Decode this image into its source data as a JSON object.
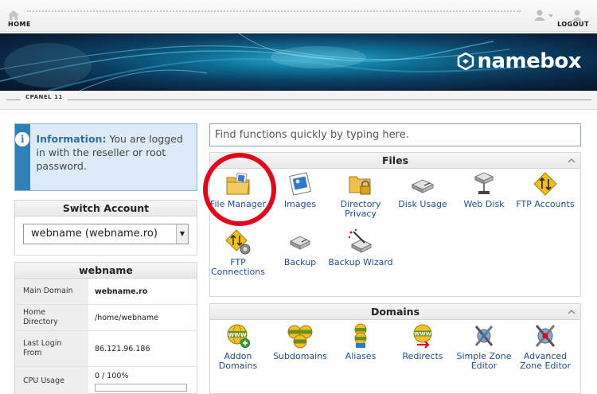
{
  "topbar": {
    "home_label": "HOME",
    "logout_label": "LOGOUT"
  },
  "banner": {
    "logo_text": "namebox"
  },
  "cpanel": {
    "label": "CPANEL 11"
  },
  "info": {
    "title": "Information:",
    "message": "You are logged in with the reseller or root password."
  },
  "switch_account": {
    "title": "Switch Account",
    "selected": "webname (webname.ro)"
  },
  "account": {
    "title": "webname",
    "rows": [
      {
        "label": "Main Domain",
        "value": "webname.ro"
      },
      {
        "label": "Home Directory",
        "value": "/home/webname"
      },
      {
        "label": "Last Login From",
        "value": "86.121.96.186"
      },
      {
        "label": "CPU Usage",
        "value": "0 / 100%"
      }
    ]
  },
  "search": {
    "placeholder": "Find functions quickly by typing here."
  },
  "files": {
    "title": "Files",
    "items": [
      {
        "label": "File Manager",
        "icon": "file-manager-icon"
      },
      {
        "label": "Images",
        "icon": "images-icon"
      },
      {
        "label": "Directory Privacy",
        "icon": "directory-privacy-icon"
      },
      {
        "label": "Disk Usage",
        "icon": "disk-usage-icon"
      },
      {
        "label": "Web Disk",
        "icon": "web-disk-icon"
      },
      {
        "label": "FTP Accounts",
        "icon": "ftp-accounts-icon"
      },
      {
        "label": "FTP Connections",
        "icon": "ftp-connections-icon"
      },
      {
        "label": "Backup",
        "icon": "backup-icon"
      },
      {
        "label": "Backup Wizard",
        "icon": "backup-wizard-icon"
      }
    ]
  },
  "domains": {
    "title": "Domains",
    "items": [
      {
        "label": "Addon Domains",
        "icon": "addon-domains-icon"
      },
      {
        "label": "Subdomains",
        "icon": "subdomains-icon"
      },
      {
        "label": "Aliases",
        "icon": "aliases-icon"
      },
      {
        "label": "Redirects",
        "icon": "redirects-icon"
      },
      {
        "label": "Simple Zone Editor",
        "icon": "simple-zone-editor-icon"
      },
      {
        "label": "Advanced Zone Editor",
        "icon": "advanced-zone-editor-icon"
      }
    ]
  },
  "colors": {
    "accent": "#2f80b7",
    "highlight": "#e0071c",
    "link": "#1f4e8a",
    "banner": "#0b3f63"
  }
}
